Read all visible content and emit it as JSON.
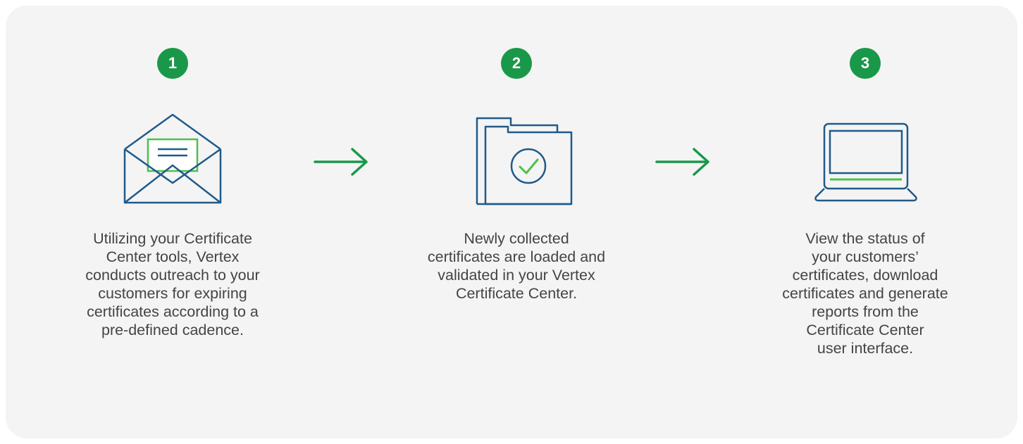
{
  "colors": {
    "panel_background": "#f4f4f4",
    "badge_green": "#1a9849",
    "icon_blue": "#1f5a8a",
    "accent_green": "#4cc14a",
    "arrow_green": "#1a9849",
    "text": "#444444"
  },
  "steps": [
    {
      "number": "1",
      "icon": "envelope-icon",
      "description": "Utilizing your Certificate\nCenter tools, Vertex\nconducts outreach to your\ncustomers for expiring\ncertificates according to a\npre-defined cadence."
    },
    {
      "number": "2",
      "icon": "folder-check-icon",
      "description": "Newly collected\ncertificates are loaded and\nvalidated in your Vertex\nCertificate Center."
    },
    {
      "number": "3",
      "icon": "laptop-icon",
      "description": "View the status of\nyour customers’\ncertificates, download\ncertificates and generate\nreports from the\nCertificate Center\nuser interface."
    }
  ],
  "arrows": [
    {
      "icon": "arrow-right-icon"
    },
    {
      "icon": "arrow-right-icon"
    }
  ]
}
